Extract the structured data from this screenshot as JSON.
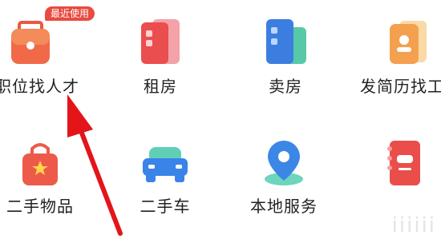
{
  "badge": {
    "recent": "最近使用"
  },
  "grid": {
    "items": [
      {
        "label": "发职位找人才",
        "icon": "briefcase-icon"
      },
      {
        "label": "租房",
        "icon": "building-red-icon"
      },
      {
        "label": "卖房",
        "icon": "building-blue-icon"
      },
      {
        "label": "发简历找工作",
        "icon": "resume-card-icon"
      },
      {
        "label": "二手物品",
        "icon": "shopping-bag-icon"
      },
      {
        "label": "二手车",
        "icon": "car-icon"
      },
      {
        "label": "本地服务",
        "icon": "map-pin-icon"
      },
      {
        "label": "",
        "icon": "notebook-car-icon"
      }
    ]
  },
  "watermark": {
    "text": "iiiiii"
  }
}
